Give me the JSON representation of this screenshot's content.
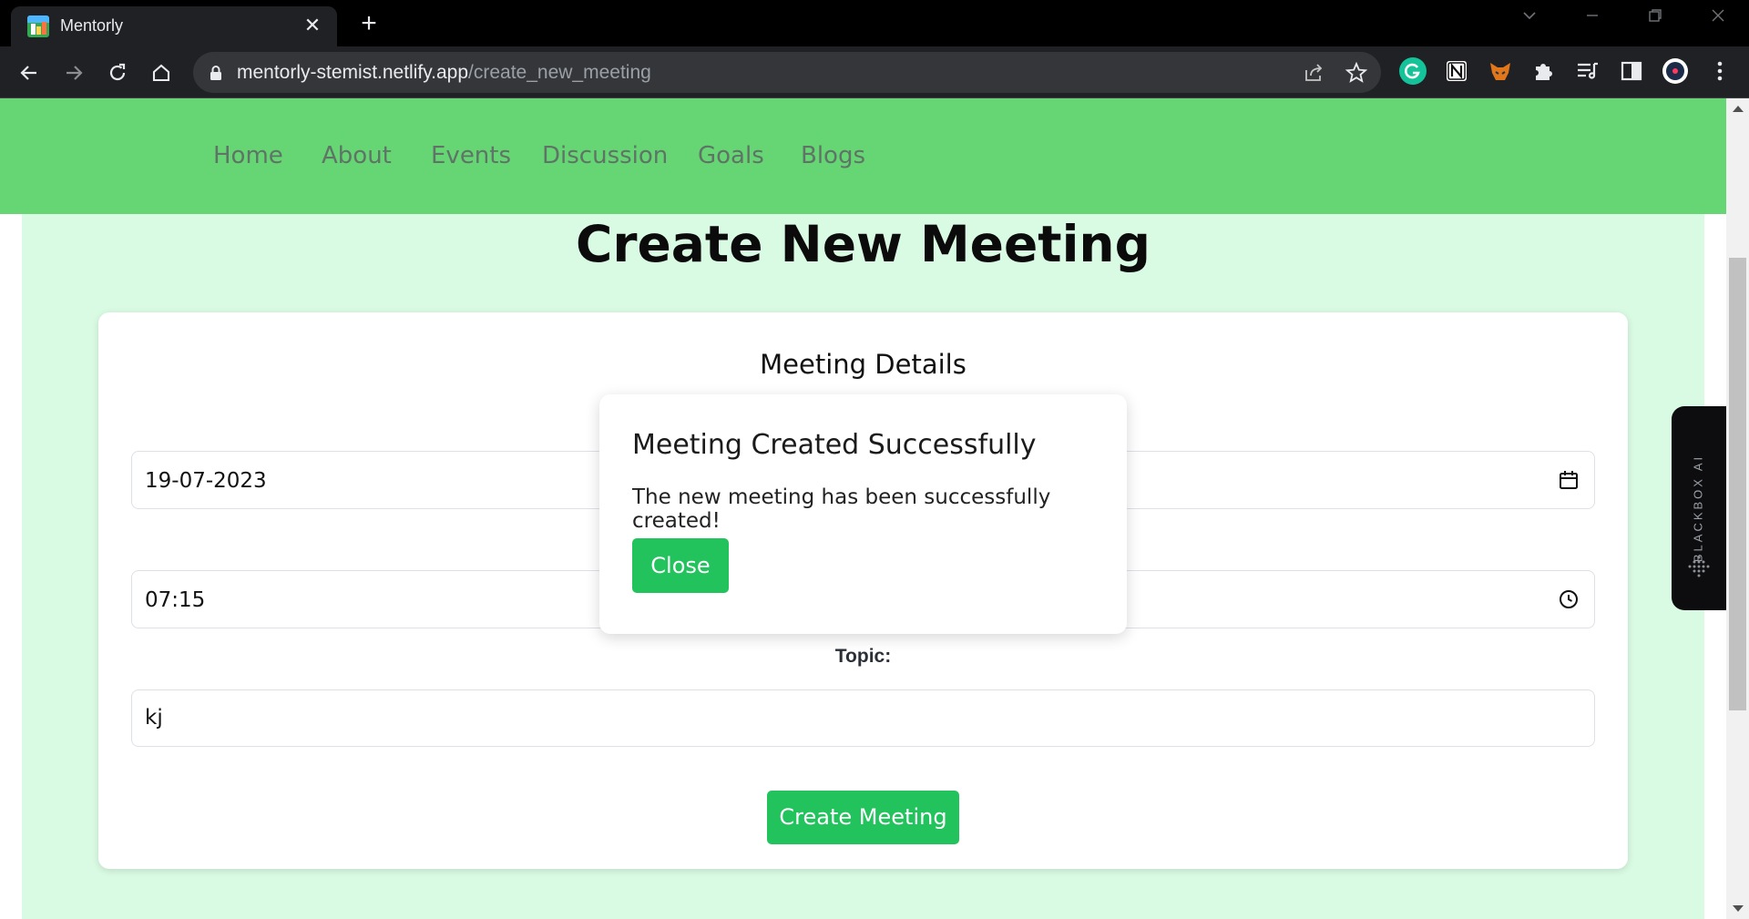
{
  "browser": {
    "tab_title": "Mentorly",
    "tab_close": "✕",
    "new_tab": "+",
    "url_host": "mentorly-stemist.netlify.app",
    "url_path": "/create_new_meeting"
  },
  "nav": {
    "links": [
      "Home",
      "About",
      "Events",
      "Discussion",
      "Goals",
      "Blogs"
    ]
  },
  "page": {
    "title": "Create New Meeting"
  },
  "form": {
    "section_title": "Meeting Details",
    "date_value": "19-07-2023",
    "time_value": "07:15",
    "topic_label": "Topic:",
    "topic_value": "kj",
    "submit_label": "Create Meeting"
  },
  "modal": {
    "title": "Meeting Created Successfully",
    "message": "The new meeting has been successfully created!",
    "close_label": "Close"
  },
  "sidebar_widget": {
    "label": "BLACKBOX AI"
  },
  "colors": {
    "navbar": "#65d673",
    "page_bg": "#d9fae3",
    "primary_button": "#22c35c"
  }
}
